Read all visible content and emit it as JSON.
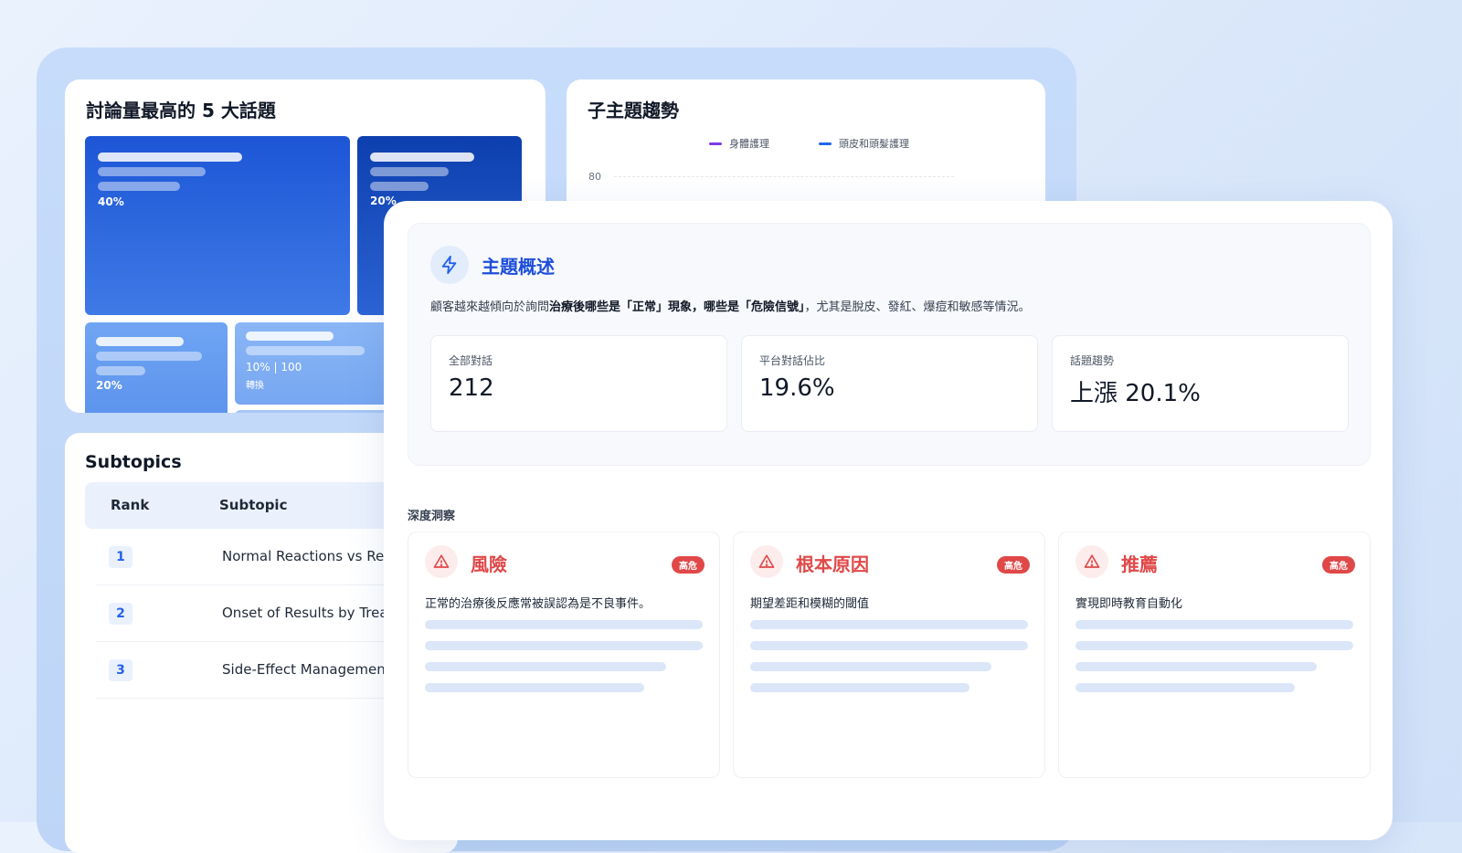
{
  "top5": {
    "title": "討論量最高的 5 大話題",
    "tiles": [
      {
        "pct": "40%"
      },
      {
        "pct": "20%"
      },
      {
        "pct": "20%"
      },
      {
        "pct": "10% | 100",
        "sub": "轉換"
      }
    ],
    "colors": {
      "dark": "#1d4fd0",
      "light": "#5f97ef"
    }
  },
  "trend": {
    "title": "子主題趨勢",
    "legend": [
      {
        "label": "身體護理",
        "color": "#7c3aed"
      },
      {
        "label": "頭皮和頭髮護理",
        "color": "#2563eb"
      }
    ],
    "y_tick": "80"
  },
  "subtopics": {
    "title": "Subtopics",
    "headers": {
      "rank": "Rank",
      "subtopic": "Subtopic"
    },
    "rows": [
      {
        "rank": "1",
        "name": "Normal Reactions vs Rec"
      },
      {
        "rank": "2",
        "name": "Onset of Results by Trea"
      },
      {
        "rank": "3",
        "name": "Side-Effect Managemen"
      }
    ]
  },
  "overview": {
    "title": "主題概述",
    "desc_pre": "顧客越來越傾向於詢問",
    "desc_bold": "治療後哪些是「正常」現象，哪些是「危險信號」",
    "desc_post": "，尤其是脫皮、發紅、爆痘和敏感等情況。",
    "stats": [
      {
        "label": "全部對話",
        "value": "212"
      },
      {
        "label": "平台對話佔比",
        "value": "19.6%"
      },
      {
        "label": "話題趨勢",
        "value": "上漲 20.1%"
      }
    ]
  },
  "insights": {
    "section_label": "深度洞察",
    "items": [
      {
        "title": "風險",
        "badge": "高危",
        "text": "正常的治療後反應常被誤認為是不良事件。"
      },
      {
        "title": "根本原因",
        "badge": "高危",
        "text": "期望差距和模糊的閾值"
      },
      {
        "title": "推薦",
        "badge": "高危",
        "text": "實現即時教育自動化"
      }
    ],
    "accent": "#e04848"
  },
  "icons": [
    "lightning-icon",
    "warning-icon"
  ]
}
